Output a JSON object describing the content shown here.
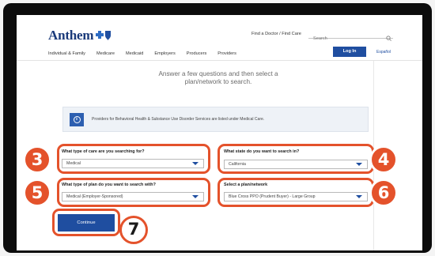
{
  "header": {
    "logo_text": "Anthem",
    "find_doctor": "Find a Doctor / Find Care",
    "search_placeholder": "Search",
    "login": "Log In",
    "espanol": "Español"
  },
  "nav": [
    "Individual & Family",
    "Medicare",
    "Medicaid",
    "Employers",
    "Producers",
    "Providers"
  ],
  "headline": "Answer a few questions and then select a plan/network to search.",
  "info_banner": {
    "icon": "info-icon",
    "text": "Providers for Behavioral Health & Substance Use Disorder Services are listed under Medical Care."
  },
  "form": {
    "care_type": {
      "label": "What type of care are you searching for?",
      "value": "Medical"
    },
    "state": {
      "label": "What state do you want to search in?",
      "value": "California"
    },
    "plan_type": {
      "label": "What type of plan do you want to search with?",
      "value": "Medical (Employer-Sponsored)"
    },
    "plan_network": {
      "label": "Select a plan/network",
      "value": "Blue Cross PPO (Prudent Buyer) - Large Group"
    },
    "continue": "Continue"
  },
  "callouts": [
    "3",
    "4",
    "5",
    "6",
    "7"
  ],
  "colors": {
    "accent": "#e4522b",
    "brand": "#1f4ea0"
  }
}
